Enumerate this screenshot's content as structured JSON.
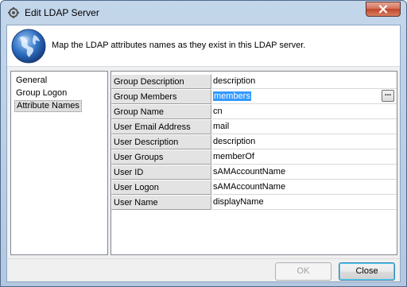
{
  "window": {
    "title": "Edit LDAP Server",
    "close_icon": "close-icon"
  },
  "header": {
    "icon": "globe-icon",
    "text": "Map the LDAP attributes names as they exist in this LDAP server."
  },
  "nav": {
    "items": [
      {
        "label": "General",
        "selected": false
      },
      {
        "label": "Group Logon",
        "selected": false
      },
      {
        "label": "Attribute Names",
        "selected": true
      }
    ]
  },
  "attributes": [
    {
      "name": "Group Description",
      "value": "description"
    },
    {
      "name": "Group Members",
      "value": "members",
      "editing": true
    },
    {
      "name": "Group Name",
      "value": "cn"
    },
    {
      "name": "User Email Address",
      "value": "mail"
    },
    {
      "name": "User Description",
      "value": "description"
    },
    {
      "name": "User Groups",
      "value": "memberOf"
    },
    {
      "name": "User ID",
      "value": "sAMAccountName"
    },
    {
      "name": "User Logon",
      "value": "sAMAccountName"
    },
    {
      "name": "User Name",
      "value": "displayName"
    }
  ],
  "editor": {
    "ellipsis_label": "..."
  },
  "footer": {
    "ok_label": "OK",
    "ok_enabled": false,
    "close_label": "Close"
  },
  "colors": {
    "selection": "#3399ff",
    "title_bar": "#c3d6ea",
    "close_button": "#c1462b"
  }
}
